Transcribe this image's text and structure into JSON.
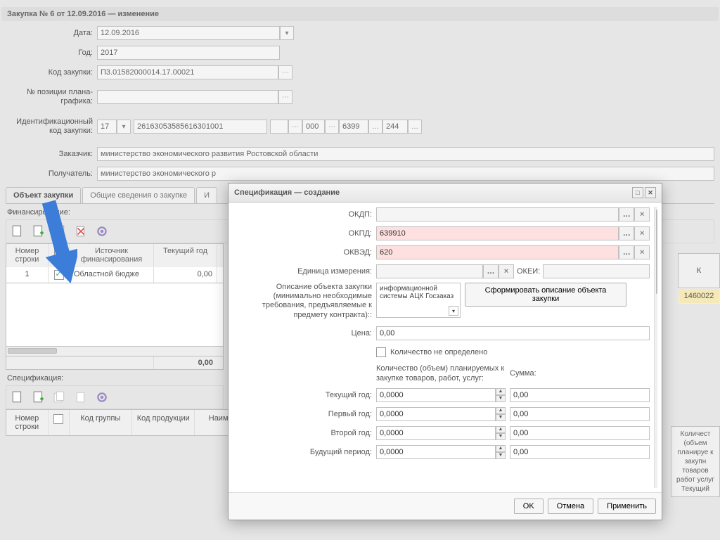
{
  "windowTitle": "Закупка № 6 от 12.09.2016 — изменение",
  "labels": {
    "date": "Дата:",
    "year": "Год:",
    "purchaseCode": "Код закупки:",
    "planPosition": "№ позиции плана-графика:",
    "identCode": "Идентификационный код закупки:",
    "customer": "Заказчик:",
    "recipient": "Получатель:",
    "financing": "Финансирование:",
    "specification": "Спецификация:"
  },
  "fields": {
    "date": "12.09.2016",
    "year": "2017",
    "purchaseCode": "П3.01582000014.17.00021",
    "ident1": "17",
    "ident2": "26163053585616301001",
    "ident3": "000",
    "ident4": "6399",
    "ident5": "244",
    "customer": "министерство экономического развития Ростовской области",
    "recipient": "министерство экономического р"
  },
  "tabs": {
    "t1": "Объект закупки",
    "t2": "Общие сведения о закупке",
    "t3": "И"
  },
  "grid": {
    "h1": "Номер строки",
    "h2": "",
    "h3": "Источник финансирования",
    "h4": "Текущий год",
    "r1c1": "1",
    "r1c3": "Областной бюдже",
    "r1c4": "0,00",
    "total": "0,00"
  },
  "specGrid": {
    "h1": "Номер строки",
    "h3": "Код группы",
    "h4": "Код продукции",
    "h5": "Наимен"
  },
  "rightHead": "К",
  "rightVal": "1460022",
  "rightList": "Количест (объем планируе к закупн товаров работ услуг Текущий",
  "modal": {
    "title": "Спецификация — создание",
    "lbl_okdp": "ОКДП:",
    "lbl_okpd": "ОКПД:",
    "lbl_okved": "ОКВЭД:",
    "lbl_unit": "Единица измерения:",
    "lbl_okei": "ОКЕИ:",
    "lbl_desc": "Описание объекта закупки (минимально необходимые требования, предъявляемые к предмету контракта)::",
    "desc_text": "информационной системы АЦК Госзаказ",
    "btn_form_desc": "Сформировать описание объекта закупки",
    "lbl_price": "Цена:",
    "val_price": "0,00",
    "chk_qty": "Количество не определено",
    "lbl_qty": "Количество (объем) планируемых к закупке товаров, работ, услуг:",
    "lbl_sum": "Сумма:",
    "lbl_cur": "Текущий год:",
    "lbl_y1": "Первый год:",
    "lbl_y2": "Второй год:",
    "lbl_future": "Будущий период:",
    "val_okpd": "639910",
    "val_okved": "620",
    "val_q": "0,0000",
    "val_s": "0,00",
    "btn_ok": "OK",
    "btn_cancel": "Отмена",
    "btn_apply": "Применить"
  }
}
